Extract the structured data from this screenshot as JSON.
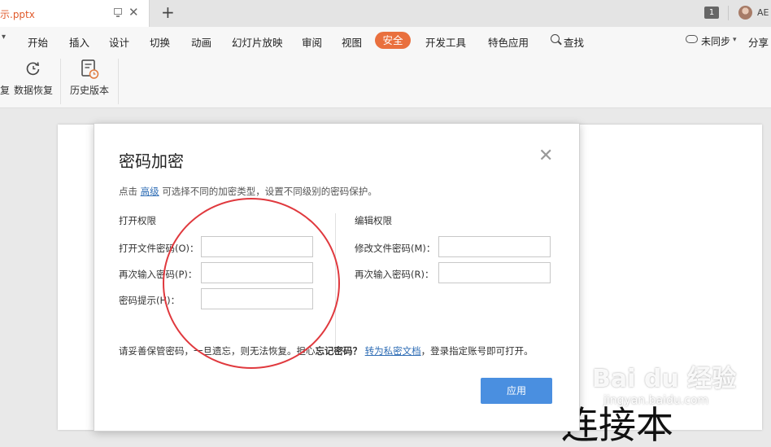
{
  "titlebar": {
    "doc_tab_title": "示.pptx",
    "new_tab_icon": "+",
    "window_count": "1",
    "user_name": "AE"
  },
  "menu": {
    "items": [
      "开始",
      "插入",
      "设计",
      "切换",
      "动画",
      "幻灯片放映",
      "审阅",
      "视图",
      "安全",
      "开发工具",
      "特色应用",
      "查找"
    ],
    "active": "安全",
    "sync_status": "未同步",
    "share": "分享"
  },
  "ribbon": {
    "items": [
      {
        "label": "复",
        "icon": "partial-icon"
      },
      {
        "label": "数据恢复",
        "icon": "data-recovery-icon"
      },
      {
        "label": "历史版本",
        "icon": "history-version-icon"
      }
    ]
  },
  "dialog": {
    "title": "密码加密",
    "desc_prefix": "点击",
    "desc_link": "高级",
    "desc_suffix": "可选择不同的加密类型，设置不同级别的密码保护。",
    "open_section": {
      "title": "打开权限",
      "fields": [
        {
          "label": "打开文件密码(O)：",
          "value": ""
        },
        {
          "label": "再次输入密码(P)：",
          "value": ""
        },
        {
          "label": "密码提示(H)：",
          "value": ""
        }
      ]
    },
    "edit_section": {
      "title": "编辑权限",
      "fields": [
        {
          "label": "修改文件密码(M)：",
          "value": ""
        },
        {
          "label": "再次输入密码(R)：",
          "value": ""
        }
      ]
    },
    "warning_prefix": "请妥善保管密码，一旦遗忘，则无法恢复。担心",
    "warning_bold": "忘记密码？",
    "warning_link": "转为私密文档",
    "warning_suffix": "，登录指定账号即可打开。",
    "apply_label": "应用"
  },
  "slide": {
    "visible_text": "连接本"
  },
  "watermark": {
    "logo": "Bai du 经验",
    "url": "jingyan.baidu.com"
  },
  "colors": {
    "accent": "#e9703e",
    "button_blue": "#4a8fe0",
    "annotation_red": "#e0393e",
    "link": "#2f6db5"
  }
}
